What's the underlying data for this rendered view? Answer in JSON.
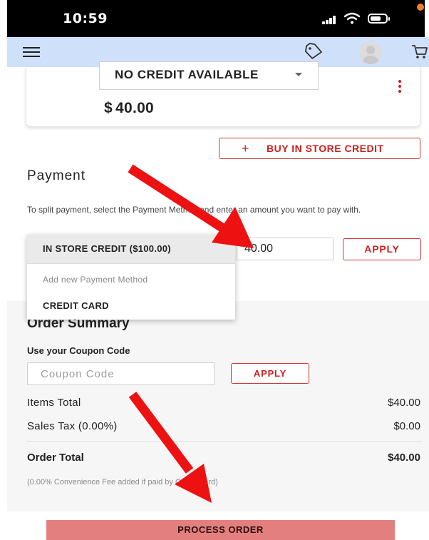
{
  "status_bar": {
    "time": "10:59"
  },
  "credit": {
    "select_label": "NO CREDIT AVAILABLE",
    "currency": "$",
    "amount": "40.00"
  },
  "buy_credit": {
    "plus": "+",
    "label": "BUY IN STORE CREDIT"
  },
  "payment": {
    "title": "Payment",
    "description": "To split payment, select the Payment Method and enter an amount you want to pay with.",
    "amount_value": "40.00",
    "apply_label": "APPLY"
  },
  "dropdown": {
    "items": [
      {
        "label": "IN STORE CREDIT ($100.00)"
      },
      {
        "label": "Add new Payment Method"
      },
      {
        "label": "CREDIT CARD"
      }
    ]
  },
  "summary": {
    "title": "Order Summary",
    "coupon_label": "Use your Coupon Code",
    "coupon_placeholder": "Coupon Code",
    "coupon_apply": "APPLY",
    "items_total_label": "Items Total",
    "items_total_value": "$40.00",
    "sales_tax_label": "Sales Tax (0.00%)",
    "sales_tax_value": "$0.00",
    "order_total_label": "Order Total",
    "order_total_value": "$40.00",
    "fee_note": "(0.00% Convenience Fee added if paid by Credit Card)"
  },
  "process_order_label": "PROCESS ORDER",
  "colors": {
    "header_bg": "#cfe0fb",
    "accent_red": "#d21d1d",
    "process_btn": "#e47f7f",
    "annotation_arrow": "#ee1111"
  },
  "icons": [
    "menu-icon",
    "tag-icon",
    "avatar",
    "cart-icon",
    "kebab-icon",
    "signal-icon",
    "wifi-icon",
    "battery-icon"
  ]
}
